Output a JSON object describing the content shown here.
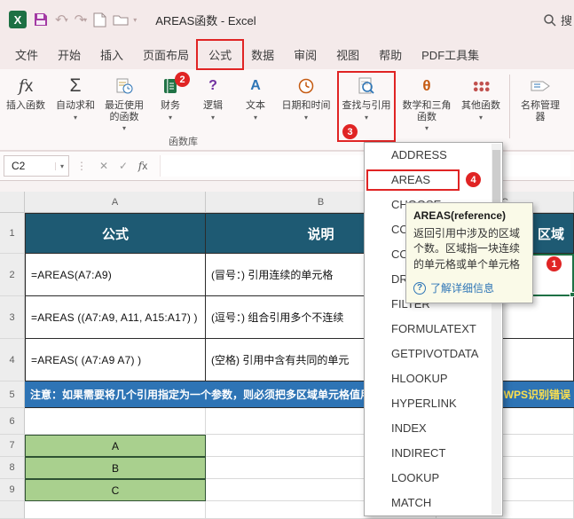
{
  "colors": {
    "annotation_red": "#E02424",
    "header_blue": "#1E5A73",
    "note_blue": "#2E74B5",
    "cell_green": "#A9D08E",
    "selection_green": "#1E7145",
    "excel_green": "#1D7044"
  },
  "icons": {
    "caret": "▾",
    "undo": "↶",
    "redo": "↷",
    "sigma": "Σ",
    "dots": "⋮",
    "cancel": "✕",
    "enter": "✓",
    "theta": "θ",
    "question": "?",
    "text_a": "A",
    "fx_f": "f",
    "fx_x": "x"
  },
  "titlebar": {
    "title": "AREAS函数 - Excel",
    "search_label": "搜"
  },
  "menubar": {
    "items": [
      "文件",
      "开始",
      "插入",
      "页面布局",
      "公式",
      "数据",
      "审阅",
      "视图",
      "帮助",
      "PDF工具集"
    ]
  },
  "ribbon": {
    "group_label": "函数库",
    "buttons": {
      "insert_function": "插入函数",
      "autosum": "自动求和",
      "recent": "最近使用的函数",
      "financial": "财务",
      "logical": "逻辑",
      "text": "文本",
      "datetime": "日期和时间",
      "lookup": "查找与引用",
      "math": "数学和三角函数",
      "more": "其他函数",
      "name_manager": "名称管理器"
    }
  },
  "formula_bar": {
    "name_box": "C2"
  },
  "function_dropdown": {
    "items": [
      "ADDRESS",
      "AREAS",
      "CHOOSE",
      "COLUMN",
      "COLUMNS",
      "DROP",
      "FILTER",
      "FORMULATEXT",
      "GETPIVOTDATA",
      "HLOOKUP",
      "HYPERLINK",
      "INDEX",
      "INDIRECT",
      "LOOKUP",
      "MATCH"
    ],
    "highlighted": "AREAS"
  },
  "tooltip": {
    "title": "AREAS(reference)",
    "body": "返回引用中涉及的区域个数。区域指一块连续的单元格或单个单元格",
    "link": "了解详细信息"
  },
  "annotations": {
    "step1": "1",
    "step2": "2",
    "step3": "3",
    "step4": "4"
  },
  "sheet": {
    "column_headers": [
      "A",
      "B",
      "C"
    ],
    "row_numbers": [
      "1",
      "2",
      "3",
      "4",
      "5",
      "6",
      "7",
      "8",
      "9"
    ],
    "table": {
      "header": {
        "a": "公式",
        "b": "说明",
        "c": "区域"
      },
      "rows": [
        {
          "a": "=AREAS(A7:A9)",
          "b": "(冒号：) 引用连续的单元格"
        },
        {
          "a": "=AREAS ((A7:A9, A11, A15:A17) )",
          "b": "(逗号：) 组合引用多个不连续"
        },
        {
          "a": "=AREAS( (A7:A9 A7) )",
          "b": "(空格) 引用中含有共同的单元"
        }
      ]
    },
    "note": {
      "left": "注意：如果需要将几个引用指定为一个参数，则必须把多区域单元格值用",
      "right": "WPS识别错误"
    },
    "cells_a7_a9": [
      "A",
      "B",
      "C"
    ]
  }
}
